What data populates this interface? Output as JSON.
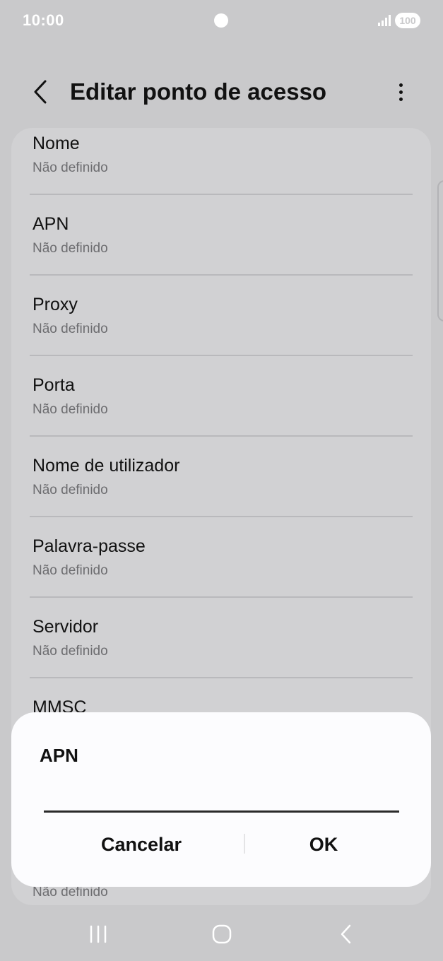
{
  "status_bar": {
    "time": "10:00",
    "battery": "100",
    "icons": [
      "camera-dot",
      "signal-icon",
      "battery-icon"
    ]
  },
  "header": {
    "title": "Editar ponto de acesso",
    "back_icon": "chevron-left-icon",
    "more_icon": "more-vertical-icon"
  },
  "settings": {
    "items": [
      {
        "title": "Nome",
        "value": "Não definido"
      },
      {
        "title": "APN",
        "value": "Não definido"
      },
      {
        "title": "Proxy",
        "value": "Não definido"
      },
      {
        "title": "Porta",
        "value": "Não definido"
      },
      {
        "title": "Nome de utilizador",
        "value": "Não definido"
      },
      {
        "title": "Palavra-passe",
        "value": "Não definido"
      },
      {
        "title": "Servidor",
        "value": "Não definido"
      },
      {
        "title": "MMSC",
        "value": ""
      },
      {
        "title": "",
        "value": "Não definido"
      }
    ]
  },
  "dialog": {
    "title": "APN",
    "input_value": "",
    "cancel_label": "Cancelar",
    "ok_label": "OK"
  },
  "nav_bar": {
    "icons": [
      "recents-icon",
      "home-icon",
      "back-icon"
    ]
  },
  "colors": {
    "background": "#c9c9cb",
    "card": "#d1d1d3",
    "dialog": "#fcfcfe",
    "secondary_text": "#6d6d70"
  }
}
